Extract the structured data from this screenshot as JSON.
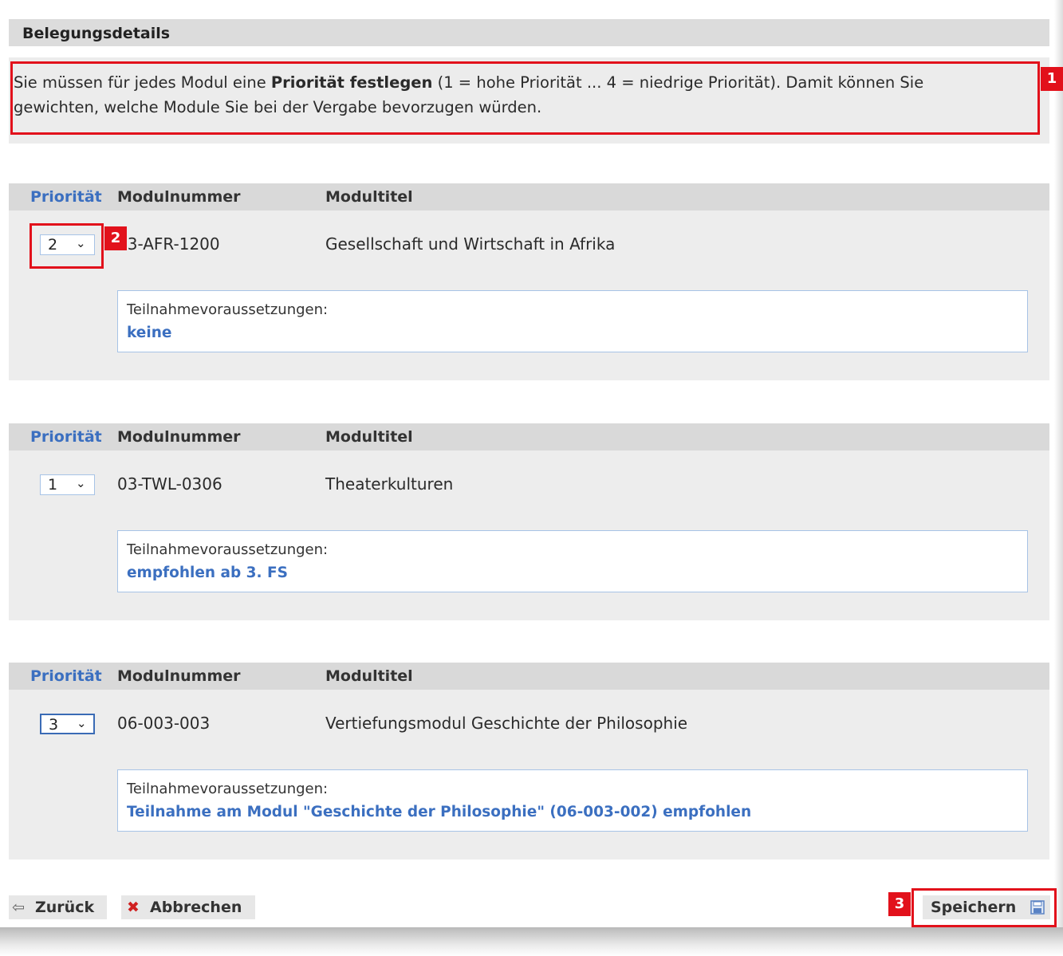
{
  "header": {
    "title": "Belegungsdetails"
  },
  "info": {
    "text_before": "Sie müssen für jedes Modul eine ",
    "text_bold": "Priorität festlegen",
    "text_after_line1": " (1 = hohe Priorität ... 4 = niedrige Priorität). Damit können Sie",
    "text_line2": "gewichten, welche Module Sie bei der Vergabe bevorzugen würden."
  },
  "columns": {
    "priority": "Priorität",
    "module_number": "Modulnummer",
    "module_title": "Modultitel"
  },
  "modules": [
    {
      "priority": "2",
      "number": "03-AFR-1200",
      "title": "Gesellschaft und Wirtschaft in Afrika",
      "req_label": "Teilnahmevoraussetzungen:",
      "req_value": "keine"
    },
    {
      "priority": "1",
      "number": "03-TWL-0306",
      "title": "Theaterkulturen",
      "req_label": "Teilnahmevoraussetzungen:",
      "req_value": "empfohlen ab 3. FS"
    },
    {
      "priority": "3",
      "number": "06-003-003",
      "title": "Vertiefungsmodul Geschichte der Philosophie",
      "req_label": "Teilnahmevoraussetzungen:",
      "req_value": "Teilnahme am Modul \"Geschichte der Philosophie\" (06-003-002) empfohlen"
    }
  ],
  "footer": {
    "back": "Zurück",
    "cancel": "Abbrechen",
    "save": "Speichern"
  },
  "icons": {
    "back": "arrow-left-icon",
    "cancel": "x-icon",
    "save": "floppy-disk-icon",
    "dropdown": "chevron-down-icon"
  },
  "markers": [
    "1",
    "2",
    "3"
  ],
  "colors": {
    "marker": "#e2111b",
    "accent": "#3b6fc0"
  }
}
